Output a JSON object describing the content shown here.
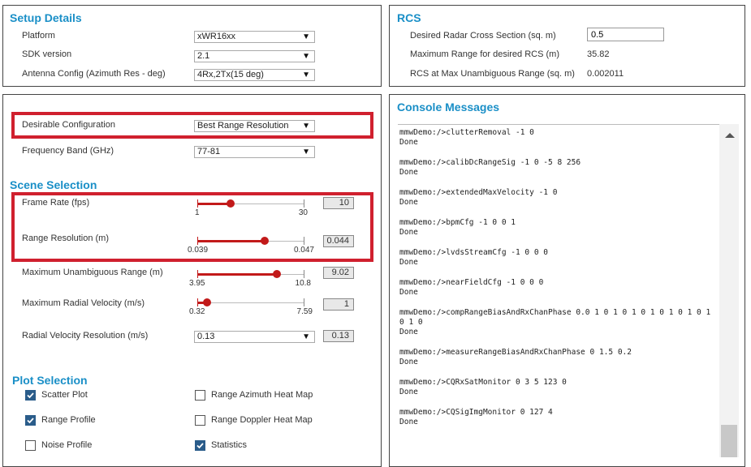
{
  "setup": {
    "title": "Setup Details",
    "platform_label": "Platform",
    "platform_value": "xWR16xx",
    "sdk_label": "SDK version",
    "sdk_value": "2.1",
    "antenna_label": "Antenna Config (Azimuth Res - deg)",
    "antenna_value": "4Rx,2Tx(15 deg)"
  },
  "rcs": {
    "title": "RCS",
    "desired_label": "Desired Radar Cross Section (sq. m)",
    "desired_value": "0.5",
    "maxrange_label": "Maximum Range for desired RCS (m)",
    "maxrange_value": "35.82",
    "rcsmax_label": "RCS at Max Unambiguous Range (sq. m)",
    "rcsmax_value": "0.002011"
  },
  "config": {
    "desirable_label": "Desirable Configuration",
    "desirable_value": "Best Range Resolution",
    "freq_label": "Frequency Band (GHz)",
    "freq_value": "77-81"
  },
  "scene": {
    "title": "Scene Selection",
    "frame_rate": {
      "label": "Frame Rate (fps)",
      "min": "1",
      "max": "30",
      "value": "10",
      "fraction": 0.31
    },
    "range_res": {
      "label": "Range Resolution (m)",
      "min": "0.039",
      "max": "0.047",
      "value": "0.044",
      "fraction": 0.625
    },
    "max_range": {
      "label": "Maximum Unambiguous Range (m)",
      "min": "3.95",
      "max": "10.8",
      "value": "9.02",
      "fraction": 0.74
    },
    "max_vel": {
      "label": "Maximum Radial Velocity (m/s)",
      "min": "0.32",
      "max": "7.59",
      "value": "1",
      "fraction": 0.09
    },
    "vel_res": {
      "label": "Radial Velocity Resolution (m/s)",
      "select_value": "0.13",
      "value": "0.13"
    }
  },
  "plot": {
    "title": "Plot Selection",
    "scatter": {
      "label": "Scatter Plot",
      "checked": true
    },
    "range_profile": {
      "label": "Range Profile",
      "checked": true
    },
    "noise_profile": {
      "label": "Noise Profile",
      "checked": false
    },
    "range_az_heatmap": {
      "label": "Range Azimuth Heat Map",
      "checked": false
    },
    "range_doppler_heatmap": {
      "label": "Range Doppler Heat Map",
      "checked": false
    },
    "statistics": {
      "label": "Statistics",
      "checked": true
    }
  },
  "console": {
    "title": "Console Messages",
    "entries": [
      {
        "cmd": "mmwDemo:/>clutterRemoval -1 0",
        "result": "Done"
      },
      {
        "cmd": "mmwDemo:/>calibDcRangeSig -1 0 -5 8 256",
        "result": "Done"
      },
      {
        "cmd": "mmwDemo:/>extendedMaxVelocity -1 0",
        "result": "Done"
      },
      {
        "cmd": "mmwDemo:/>bpmCfg -1 0 0 1",
        "result": "Done"
      },
      {
        "cmd": "mmwDemo:/>lvdsStreamCfg -1 0 0 0",
        "result": "Done"
      },
      {
        "cmd": "mmwDemo:/>nearFieldCfg -1 0 0 0",
        "result": "Done"
      },
      {
        "cmd": "mmwDemo:/>compRangeBiasAndRxChanPhase 0.0 1 0 1 0 1 0 1 0 1 0 1 0 1 0 1 0",
        "result": "Done"
      },
      {
        "cmd": "mmwDemo:/>measureRangeBiasAndRxChanPhase 0 1.5 0.2",
        "result": "Done"
      },
      {
        "cmd": "mmwDemo:/>CQRxSatMonitor 0 3 5 123 0",
        "result": "Done"
      },
      {
        "cmd": "mmwDemo:/>CQSigImgMonitor 0 127 4",
        "result": "Done"
      }
    ]
  },
  "colors": {
    "heading": "#1a8fc7",
    "highlight": "#d0202e",
    "slider": "#c21a1a",
    "checkbox": "#2a5c8a"
  }
}
